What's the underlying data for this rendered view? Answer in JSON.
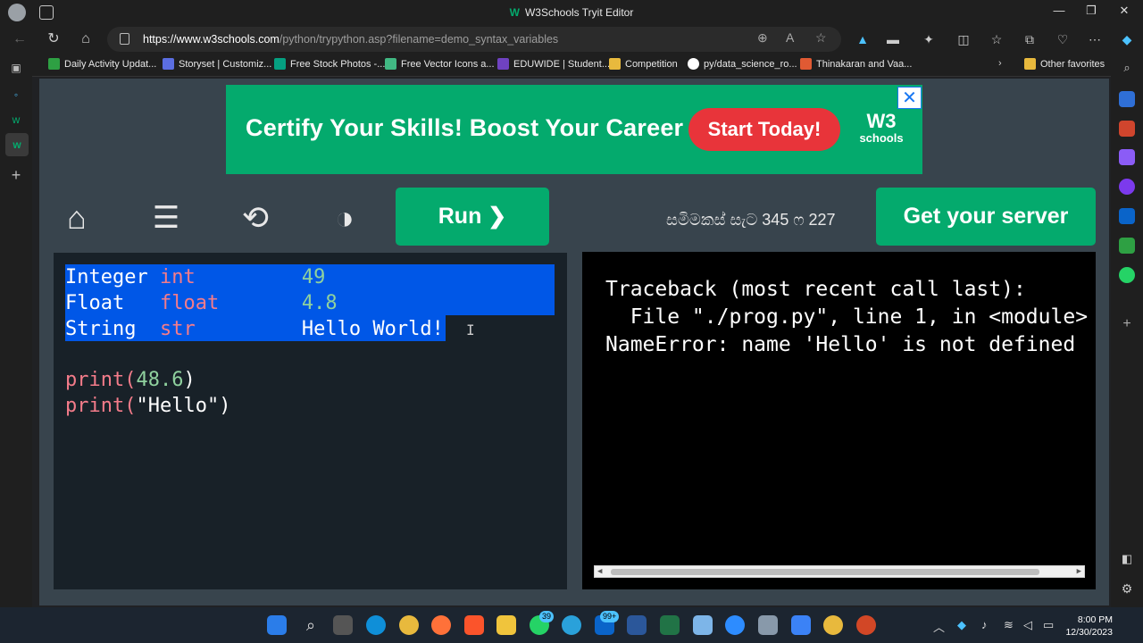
{
  "window": {
    "title": "W3Schools Tryit Editor"
  },
  "address_bar": {
    "url_host": "https://www.w3schools.com",
    "url_path": "/python/trypython.asp?filename=demo_syntax_variables"
  },
  "favorites": [
    {
      "label": "Daily Activity Updat...",
      "color": "#2ea043"
    },
    {
      "label": "Storyset | Customiz...",
      "color": "#5b6ee1"
    },
    {
      "label": "Free Stock Photos -...",
      "color": "#05a081"
    },
    {
      "label": "Free Vector Icons a...",
      "color": "#41b883"
    },
    {
      "label": "EDUWIDE | Student...",
      "color": "#6f42c1"
    },
    {
      "label": "Competition",
      "color": "#e8b93d"
    },
    {
      "label": "py/data_science_ro...",
      "color": "#ffffff"
    },
    {
      "label": "Thinakaran and Vaa...",
      "color": "#e05a33"
    }
  ],
  "favorites_more": {
    "label": "Other favorites",
    "color": "#e8b93d"
  },
  "ad": {
    "headline": "Certify Your Skills! Boost Your Career",
    "cta": "Start Today!",
    "logo_mark": "W3",
    "logo_text": "schools",
    "close": "✕"
  },
  "toolbar": {
    "run_label": "Run ❯",
    "dimensions": "සමිමකස් සැට 345 ෆ 227",
    "server_label": "Get your server"
  },
  "editor": {
    "lines": [
      {
        "c1": "Integer ",
        "c2": "int     ",
        "c3": "    49"
      },
      {
        "c1": "Float   ",
        "c2": "float   ",
        "c3": "    4.8"
      },
      {
        "c1": "String  ",
        "c2": "str     ",
        "c3": "    Hello World!"
      }
    ],
    "print1_fn": "print(",
    "print1_arg": "48.6",
    "print1_end": ")",
    "print2_fn": "print(",
    "print2_arg": "\"Hello\"",
    "print2_end": ")"
  },
  "output": {
    "lines": [
      "Traceback (most recent call last):",
      "  File \"./prog.py\", line 1, in <module>",
      "NameError: name 'Hello' is not defined"
    ]
  },
  "taskbar": {
    "badges": {
      "whatsapp": "39",
      "outlook": "99+"
    },
    "time": "8:00 PM",
    "date": "12/30/2023"
  },
  "colors": {
    "accent": "#04aa6d",
    "selection": "#0057e7",
    "ad_cta": "#e8343a"
  }
}
